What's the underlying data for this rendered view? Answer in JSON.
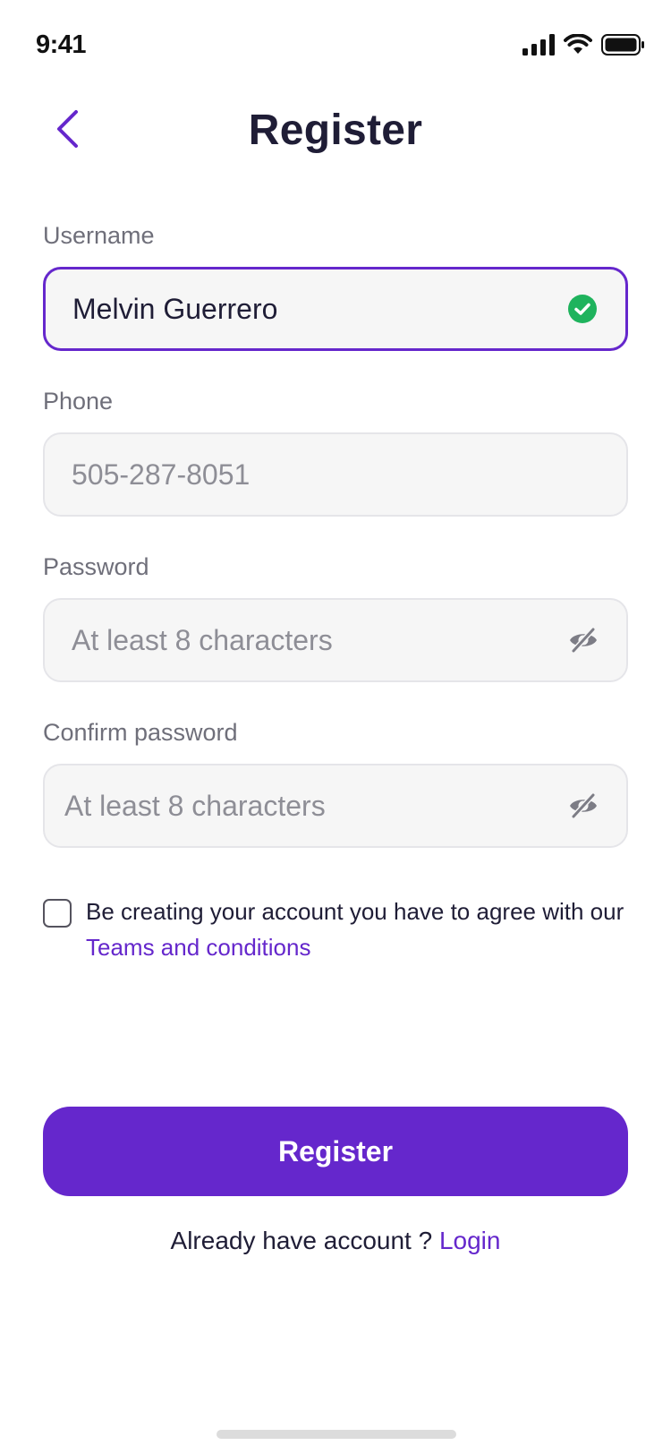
{
  "status_bar": {
    "time": "9:41"
  },
  "header": {
    "title": "Register"
  },
  "form": {
    "username": {
      "label": "Username",
      "value": "Melvin Guerrero"
    },
    "phone": {
      "label": "Phone",
      "placeholder": "505-287-8051"
    },
    "password": {
      "label": "Password",
      "placeholder": "At least 8 characters"
    },
    "confirm_password": {
      "label": "Confirm password",
      "placeholder": "At least 8 characters"
    }
  },
  "terms": {
    "text": "Be creating your account you have to agree with our ",
    "link": "Teams and conditions",
    "checked": false
  },
  "actions": {
    "register_label": "Register"
  },
  "footer": {
    "prompt": "Already have account ? ",
    "login_link": "Login"
  },
  "colors": {
    "accent": "#6527cc",
    "success": "#1fb35d"
  },
  "icons": {
    "back": "chevron-left-icon",
    "valid": "check-circle-icon",
    "visibility": "eye-off-icon"
  }
}
